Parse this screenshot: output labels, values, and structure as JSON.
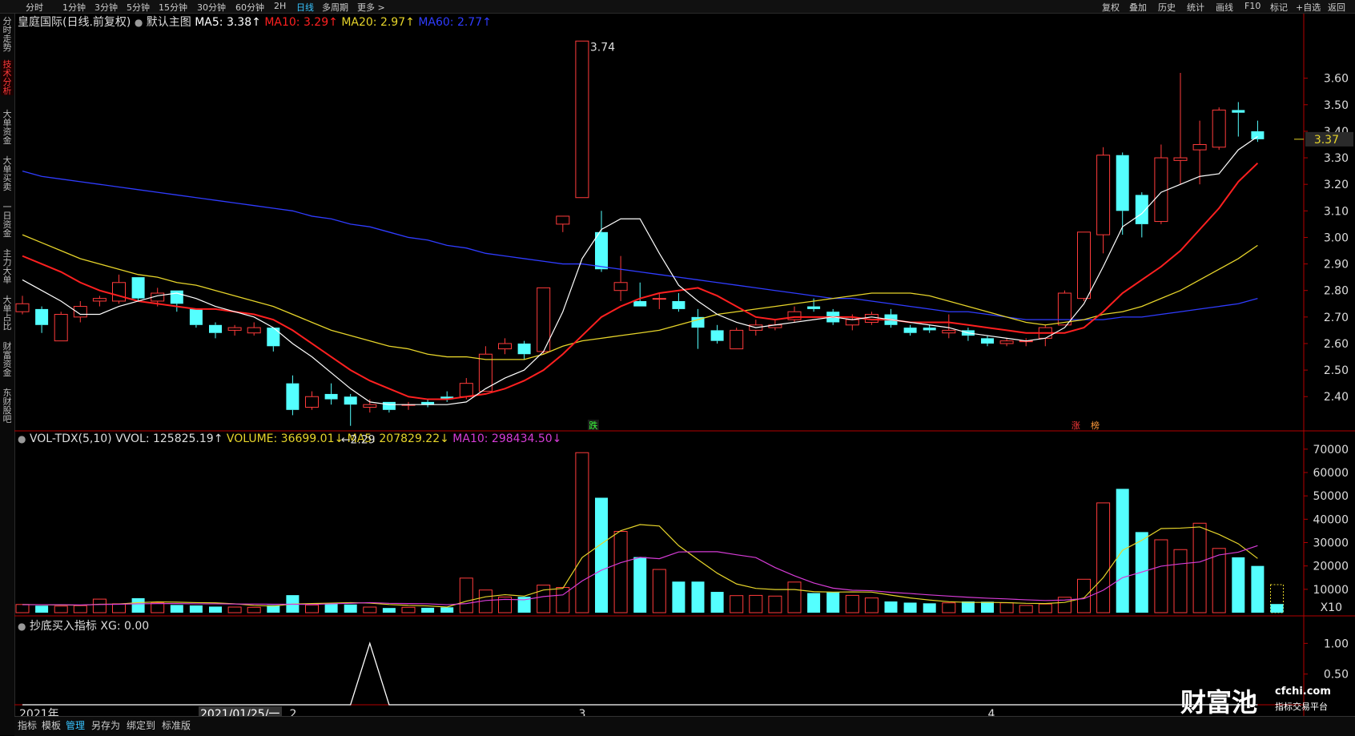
{
  "toolbar": {
    "periods": [
      "分时",
      "1分钟",
      "3分钟",
      "5分钟",
      "15分钟",
      "30分钟",
      "60分钟",
      "2H",
      "日线",
      "多周期",
      "更多 >"
    ],
    "active_period": "日线",
    "right_items": [
      "复权",
      "叠加",
      "历史",
      "统计",
      "画线",
      "F10",
      "标记",
      "+自选",
      "返回"
    ]
  },
  "sidebar_tabs": [
    "分时走势",
    "技术分析",
    "大单资金",
    "大单买卖",
    "一日资金",
    "主力大单",
    "大单占比",
    "财富资金",
    "东财股吧"
  ],
  "active_sidebar_tab": "技术分析",
  "main_panel": {
    "stock": "皇庭国际(日线.前复权)",
    "template": "默认主图",
    "ma5": "MA5: 3.38↑",
    "ma10": "MA10: 3.29↑",
    "ma20": "MA20: 2.97↑",
    "ma60": "MA60: 2.77↑",
    "high_label": "3.74",
    "low_label": "←2.29",
    "current_price": "3.37",
    "y_ticks": [
      "3.60",
      "3.50",
      "3.40",
      "3.30",
      "3.20",
      "3.10",
      "3.00",
      "2.90",
      "2.80",
      "2.70",
      "2.60",
      "2.50",
      "2.40"
    ],
    "marker_down": "跌",
    "marker_up": "涨",
    "marker_list": "榜"
  },
  "volume_panel": {
    "name": "VOL-TDX(5,10)",
    "vvol": "VVOL: 125825.19↑",
    "volume": "VOLUME: 36699.01↓",
    "ma5": "MA5: 207829.22↓",
    "ma10": "MA10: 298434.50↓",
    "y_ticks": [
      "70000",
      "60000",
      "50000",
      "40000",
      "30000",
      "20000",
      "10000"
    ],
    "unit": "X10"
  },
  "indicator_panel": {
    "name": "抄底买入指标",
    "xg": "XG: 0.00",
    "y_ticks": [
      "1.00",
      "0.50"
    ]
  },
  "x_axis": {
    "year": "2021年",
    "cursor_date": "2021/01/25/一",
    "month2": "2",
    "month3": "3",
    "month4": "4"
  },
  "bottom_bar": [
    "指标",
    "模板",
    "管理",
    "另存为",
    "绑定到",
    "标准版"
  ],
  "watermark": {
    "brand": "财富池",
    "site": "cfchi.com",
    "tagline": "指标交易平台"
  },
  "chart_data": {
    "type": "candlestick",
    "candles": [
      {
        "o": 2.72,
        "c": 2.75,
        "h": 2.78,
        "l": 2.71
      },
      {
        "o": 2.73,
        "c": 2.67,
        "h": 2.74,
        "l": 2.64
      },
      {
        "o": 2.61,
        "c": 2.71,
        "h": 2.72,
        "l": 2.61
      },
      {
        "o": 2.7,
        "c": 2.74,
        "h": 2.76,
        "l": 2.68
      },
      {
        "o": 2.76,
        "c": 2.77,
        "h": 2.78,
        "l": 2.74
      },
      {
        "o": 2.76,
        "c": 2.83,
        "h": 2.86,
        "l": 2.75
      },
      {
        "o": 2.85,
        "c": 2.77,
        "h": 2.85,
        "l": 2.76
      },
      {
        "o": 2.76,
        "c": 2.79,
        "h": 2.81,
        "l": 2.74
      },
      {
        "o": 2.8,
        "c": 2.75,
        "h": 2.8,
        "l": 2.72
      },
      {
        "o": 2.73,
        "c": 2.67,
        "h": 2.73,
        "l": 2.66
      },
      {
        "o": 2.67,
        "c": 2.64,
        "h": 2.68,
        "l": 2.62
      },
      {
        "o": 2.65,
        "c": 2.66,
        "h": 2.67,
        "l": 2.63
      },
      {
        "o": 2.64,
        "c": 2.66,
        "h": 2.68,
        "l": 2.63
      },
      {
        "o": 2.66,
        "c": 2.59,
        "h": 2.66,
        "l": 2.57
      },
      {
        "o": 2.45,
        "c": 2.35,
        "h": 2.48,
        "l": 2.33
      },
      {
        "o": 2.36,
        "c": 2.4,
        "h": 2.42,
        "l": 2.35
      },
      {
        "o": 2.41,
        "c": 2.39,
        "h": 2.45,
        "l": 2.37
      },
      {
        "o": 2.4,
        "c": 2.37,
        "h": 2.41,
        "l": 2.29
      },
      {
        "o": 2.36,
        "c": 2.37,
        "h": 2.39,
        "l": 2.34
      },
      {
        "o": 2.38,
        "c": 2.35,
        "h": 2.38,
        "l": 2.34
      },
      {
        "o": 2.37,
        "c": 2.37,
        "h": 2.38,
        "l": 2.35
      },
      {
        "o": 2.38,
        "c": 2.37,
        "h": 2.39,
        "l": 2.36
      },
      {
        "o": 2.4,
        "c": 2.39,
        "h": 2.42,
        "l": 2.38
      },
      {
        "o": 2.4,
        "c": 2.45,
        "h": 2.47,
        "l": 2.39
      },
      {
        "o": 2.42,
        "c": 2.56,
        "h": 2.59,
        "l": 2.42
      },
      {
        "o": 2.58,
        "c": 2.6,
        "h": 2.62,
        "l": 2.56
      },
      {
        "o": 2.6,
        "c": 2.56,
        "h": 2.61,
        "l": 2.54
      },
      {
        "o": 2.57,
        "c": 2.81,
        "h": 2.81,
        "l": 2.56
      },
      {
        "o": 3.05,
        "c": 3.08,
        "h": 3.08,
        "l": 3.02
      },
      {
        "o": 3.15,
        "c": 3.74,
        "h": 3.74,
        "l": 3.15
      },
      {
        "o": 3.02,
        "c": 2.88,
        "h": 3.1,
        "l": 2.87
      },
      {
        "o": 2.8,
        "c": 2.83,
        "h": 2.93,
        "l": 2.76
      },
      {
        "o": 2.76,
        "c": 2.74,
        "h": 2.83,
        "l": 2.74
      },
      {
        "o": 2.77,
        "c": 2.77,
        "h": 2.79,
        "l": 2.73
      },
      {
        "o": 2.76,
        "c": 2.73,
        "h": 2.79,
        "l": 2.72
      },
      {
        "o": 2.7,
        "c": 2.66,
        "h": 2.73,
        "l": 2.58
      },
      {
        "o": 2.65,
        "c": 2.61,
        "h": 2.67,
        "l": 2.6
      },
      {
        "o": 2.58,
        "c": 2.65,
        "h": 2.66,
        "l": 2.58
      },
      {
        "o": 2.65,
        "c": 2.67,
        "h": 2.69,
        "l": 2.63
      },
      {
        "o": 2.66,
        "c": 2.67,
        "h": 2.69,
        "l": 2.65
      },
      {
        "o": 2.69,
        "c": 2.72,
        "h": 2.74,
        "l": 2.68
      },
      {
        "o": 2.74,
        "c": 2.73,
        "h": 2.77,
        "l": 2.72
      },
      {
        "o": 2.72,
        "c": 2.68,
        "h": 2.73,
        "l": 2.67
      },
      {
        "o": 2.67,
        "c": 2.69,
        "h": 2.71,
        "l": 2.65
      },
      {
        "o": 2.68,
        "c": 2.71,
        "h": 2.72,
        "l": 2.67
      },
      {
        "o": 2.71,
        "c": 2.67,
        "h": 2.73,
        "l": 2.66
      },
      {
        "o": 2.66,
        "c": 2.64,
        "h": 2.67,
        "l": 2.63
      },
      {
        "o": 2.66,
        "c": 2.65,
        "h": 2.67,
        "l": 2.64
      },
      {
        "o": 2.64,
        "c": 2.65,
        "h": 2.71,
        "l": 2.62
      },
      {
        "o": 2.65,
        "c": 2.63,
        "h": 2.66,
        "l": 2.61
      },
      {
        "o": 2.62,
        "c": 2.6,
        "h": 2.63,
        "l": 2.59
      },
      {
        "o": 2.6,
        "c": 2.61,
        "h": 2.62,
        "l": 2.59
      },
      {
        "o": 2.61,
        "c": 2.61,
        "h": 2.62,
        "l": 2.59
      },
      {
        "o": 2.62,
        "c": 2.66,
        "h": 2.67,
        "l": 2.59
      },
      {
        "o": 2.67,
        "c": 2.79,
        "h": 2.8,
        "l": 2.67
      },
      {
        "o": 2.77,
        "c": 3.02,
        "h": 3.02,
        "l": 2.76
      },
      {
        "o": 3.01,
        "c": 3.31,
        "h": 3.34,
        "l": 2.94
      },
      {
        "o": 3.31,
        "c": 3.1,
        "h": 3.32,
        "l": 3.01
      },
      {
        "o": 3.16,
        "c": 3.05,
        "h": 3.17,
        "l": 3.0
      },
      {
        "o": 3.06,
        "c": 3.3,
        "h": 3.35,
        "l": 3.05
      },
      {
        "o": 3.29,
        "c": 3.3,
        "h": 3.62,
        "l": 3.2
      },
      {
        "o": 3.33,
        "c": 3.35,
        "h": 3.44,
        "l": 3.2
      },
      {
        "o": 3.34,
        "c": 3.48,
        "h": 3.49,
        "l": 3.33
      },
      {
        "o": 3.48,
        "c": 3.47,
        "h": 3.51,
        "l": 3.38
      },
      {
        "o": 3.4,
        "c": 3.37,
        "h": 3.44,
        "l": 3.36
      }
    ],
    "volume": [
      3500,
      3000,
      2800,
      3000,
      5800,
      3800,
      6200,
      4200,
      3300,
      3100,
      2600,
      2400,
      2300,
      3200,
      7500,
      3300,
      3800,
      3500,
      2400,
      2000,
      2300,
      2100,
      2300,
      14800,
      9700,
      6700,
      6800,
      11800,
      10800,
      68500,
      49200,
      34800,
      23800,
      18500,
      13300,
      13300,
      8900,
      7300,
      7400,
      7100,
      13100,
      8400,
      8700,
      7400,
      6300,
      4800,
      4300,
      4000,
      4200,
      4800,
      4700,
      4200,
      3100,
      3700,
      6600,
      14300,
      47000,
      53000,
      34500,
      31200,
      27000,
      38300,
      27500,
      23700,
      20000,
      3700
    ],
    "ma5_price": [
      2.84,
      2.8,
      2.76,
      2.71,
      2.71,
      2.74,
      2.76,
      2.78,
      2.79,
      2.77,
      2.74,
      2.72,
      2.7,
      2.66,
      2.6,
      2.55,
      2.49,
      2.43,
      2.38,
      2.37,
      2.37,
      2.37,
      2.37,
      2.38,
      2.43,
      2.47,
      2.5,
      2.57,
      2.72,
      2.92,
      3.03,
      3.07,
      3.07,
      2.94,
      2.82,
      2.76,
      2.71,
      2.68,
      2.66,
      2.67,
      2.68,
      2.69,
      2.7,
      2.69,
      2.7,
      2.69,
      2.68,
      2.67,
      2.66,
      2.64,
      2.63,
      2.62,
      2.61,
      2.62,
      2.66,
      2.75,
      2.89,
      3.04,
      3.09,
      3.17,
      3.2,
      3.23,
      3.24,
      3.33,
      3.38
    ],
    "ma10_price": [
      2.93,
      2.9,
      2.87,
      2.83,
      2.8,
      2.78,
      2.76,
      2.75,
      2.74,
      2.73,
      2.73,
      2.72,
      2.71,
      2.69,
      2.65,
      2.6,
      2.55,
      2.5,
      2.46,
      2.43,
      2.4,
      2.39,
      2.39,
      2.4,
      2.41,
      2.43,
      2.46,
      2.5,
      2.56,
      2.63,
      2.7,
      2.74,
      2.77,
      2.79,
      2.8,
      2.81,
      2.78,
      2.74,
      2.7,
      2.69,
      2.7,
      2.7,
      2.7,
      2.7,
      2.69,
      2.69,
      2.68,
      2.68,
      2.68,
      2.67,
      2.66,
      2.65,
      2.64,
      2.64,
      2.64,
      2.66,
      2.72,
      2.79,
      2.84,
      2.89,
      2.95,
      3.03,
      3.11,
      3.21,
      3.28
    ],
    "ma20_price": [
      3.01,
      2.98,
      2.95,
      2.92,
      2.9,
      2.88,
      2.86,
      2.85,
      2.83,
      2.82,
      2.8,
      2.78,
      2.76,
      2.74,
      2.71,
      2.68,
      2.65,
      2.63,
      2.61,
      2.59,
      2.58,
      2.56,
      2.55,
      2.55,
      2.54,
      2.54,
      2.54,
      2.56,
      2.59,
      2.61,
      2.62,
      2.63,
      2.64,
      2.65,
      2.67,
      2.69,
      2.71,
      2.72,
      2.73,
      2.74,
      2.75,
      2.76,
      2.77,
      2.78,
      2.79,
      2.79,
      2.79,
      2.78,
      2.76,
      2.74,
      2.72,
      2.7,
      2.68,
      2.67,
      2.68,
      2.69,
      2.71,
      2.72,
      2.74,
      2.77,
      2.8,
      2.84,
      2.88,
      2.92,
      2.97
    ],
    "ma60_price": [
      3.25,
      3.23,
      3.22,
      3.21,
      3.2,
      3.19,
      3.18,
      3.17,
      3.16,
      3.15,
      3.14,
      3.13,
      3.12,
      3.11,
      3.1,
      3.08,
      3.07,
      3.05,
      3.04,
      3.02,
      3.0,
      2.99,
      2.97,
      2.96,
      2.94,
      2.93,
      2.92,
      2.91,
      2.9,
      2.9,
      2.89,
      2.88,
      2.87,
      2.86,
      2.85,
      2.84,
      2.83,
      2.82,
      2.81,
      2.8,
      2.79,
      2.78,
      2.77,
      2.77,
      2.76,
      2.75,
      2.74,
      2.73,
      2.72,
      2.72,
      2.71,
      2.7,
      2.69,
      2.69,
      2.69,
      2.69,
      2.69,
      2.7,
      2.7,
      2.71,
      2.72,
      2.73,
      2.74,
      2.75,
      2.77
    ],
    "vol_ma5": [
      3500,
      3400,
      3300,
      3200,
      3600,
      3700,
      4300,
      4600,
      4500,
      4300,
      4200,
      3800,
      3100,
      2800,
      3700,
      3900,
      4100,
      4300,
      4100,
      3500,
      3100,
      2900,
      2400,
      4900,
      6800,
      7700,
      7100,
      9700,
      10400,
      23600,
      29500,
      35100,
      37700,
      37100,
      28700,
      22700,
      16900,
      12300,
      10400,
      9900,
      9900,
      9000,
      8800,
      8900,
      8800,
      7500,
      6300,
      5400,
      4700,
      4400,
      4400,
      4300,
      4000,
      3900,
      4400,
      6300,
      15000,
      26700,
      31000,
      36000,
      36200,
      36700,
      33500,
      29500,
      23200
    ],
    "vol_ma10": [
      3400,
      3400,
      3400,
      3300,
      3500,
      3600,
      3800,
      3900,
      3900,
      3800,
      3800,
      3700,
      3700,
      3600,
      3600,
      3500,
      3800,
      4000,
      4300,
      4000,
      3900,
      3800,
      3400,
      3900,
      5200,
      5700,
      5500,
      6900,
      7600,
      13600,
      18200,
      21400,
      23700,
      23100,
      26000,
      26100,
      26100,
      24800,
      23600,
      19300,
      15800,
      12700,
      10500,
      9600,
      9400,
      8700,
      8200,
      7600,
      7100,
      6600,
      6200,
      5900,
      5500,
      5200,
      5400,
      6000,
      9600,
      15000,
      17400,
      19900,
      20900,
      21700,
      24700,
      25900,
      28700
    ],
    "xg": [
      0,
      0,
      0,
      0,
      0,
      0,
      0,
      0,
      0,
      0,
      0,
      0,
      0,
      0,
      0,
      0,
      0,
      0,
      1,
      0,
      0,
      0,
      0,
      0,
      0,
      0,
      0,
      0,
      0,
      0,
      0,
      0,
      0,
      0,
      0,
      0,
      0,
      0,
      0,
      0,
      0,
      0,
      0,
      0,
      0,
      0,
      0,
      0,
      0,
      0,
      0,
      0,
      0,
      0,
      0,
      0,
      0,
      0,
      0,
      0,
      0,
      0,
      0,
      0,
      0
    ],
    "price_range": [
      2.28,
      3.78
    ],
    "volume_range": [
      0,
      72000
    ],
    "indicator_range": [
      0,
      1.2
    ],
    "colors": {
      "up": "#ff3b3b",
      "down": "#54ffff",
      "ma5": "#ffffff",
      "ma10": "#ff2020",
      "ma20": "#e6d42a",
      "ma60": "#2f3cff",
      "vol_ma5": "#e6d42a",
      "vol_ma10": "#d63cd6",
      "axis": "#b40000",
      "bg": "#000000"
    }
  }
}
